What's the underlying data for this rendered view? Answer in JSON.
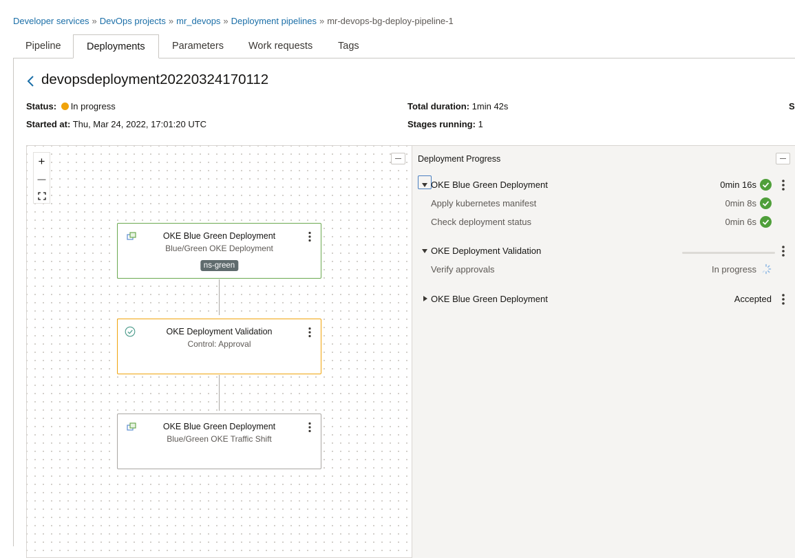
{
  "breadcrumb": {
    "items": [
      "Developer services",
      "DevOps projects",
      "mr_devops",
      "Deployment pipelines"
    ],
    "separator": "»",
    "current": "mr-devops-bg-deploy-pipeline-1"
  },
  "tabs": [
    {
      "label": "Pipeline"
    },
    {
      "label": "Deployments",
      "active": true
    },
    {
      "label": "Parameters"
    },
    {
      "label": "Work requests"
    },
    {
      "label": "Tags"
    }
  ],
  "deployment": {
    "title": "devopsdeployment20220324170112",
    "status_label": "Status:",
    "status_value": "In progress",
    "started_label": "Started at:",
    "started_value": "Thu, Mar 24, 2022, 17:01:20 UTC",
    "duration_label": "Total duration:",
    "duration_value": "1min 42s",
    "stages_label": "Stages running:",
    "stages_value": "1",
    "cut_label": "S"
  },
  "canvas": {
    "zoom_in": "+",
    "zoom_out": "—",
    "nodes": [
      {
        "title": "OKE Blue Green Deployment",
        "subtitle": "Blue/Green OKE Deployment",
        "tag": "ns-green",
        "state": "succeeded"
      },
      {
        "title": "OKE Deployment Validation",
        "subtitle": "Control: Approval",
        "state": "in-progress"
      },
      {
        "title": "OKE Blue Green Deployment",
        "subtitle": "Blue/Green OKE Traffic Shift",
        "state": "accepted"
      }
    ]
  },
  "progress": {
    "title": "Deployment Progress",
    "stages": [
      {
        "name": "OKE Blue Green Deployment",
        "value": "0min 16s",
        "tasks": [
          {
            "name": "Apply kubernetes manifest",
            "value": "0min 8s"
          },
          {
            "name": "Check deployment status",
            "value": "0min 6s"
          }
        ]
      },
      {
        "name": "OKE Deployment Validation",
        "value": "",
        "tasks": [
          {
            "name": "Verify approvals",
            "value": "In progress"
          }
        ]
      },
      {
        "name": "OKE Blue Green Deployment",
        "value": "Accepted",
        "tasks": []
      }
    ]
  },
  "colors": {
    "link": "#1a6ea7",
    "status_in_progress": "#f0a30a",
    "success": "#4f9f3a",
    "node_success_border": "#6aa84f",
    "node_progress_border": "#f0a30a"
  }
}
